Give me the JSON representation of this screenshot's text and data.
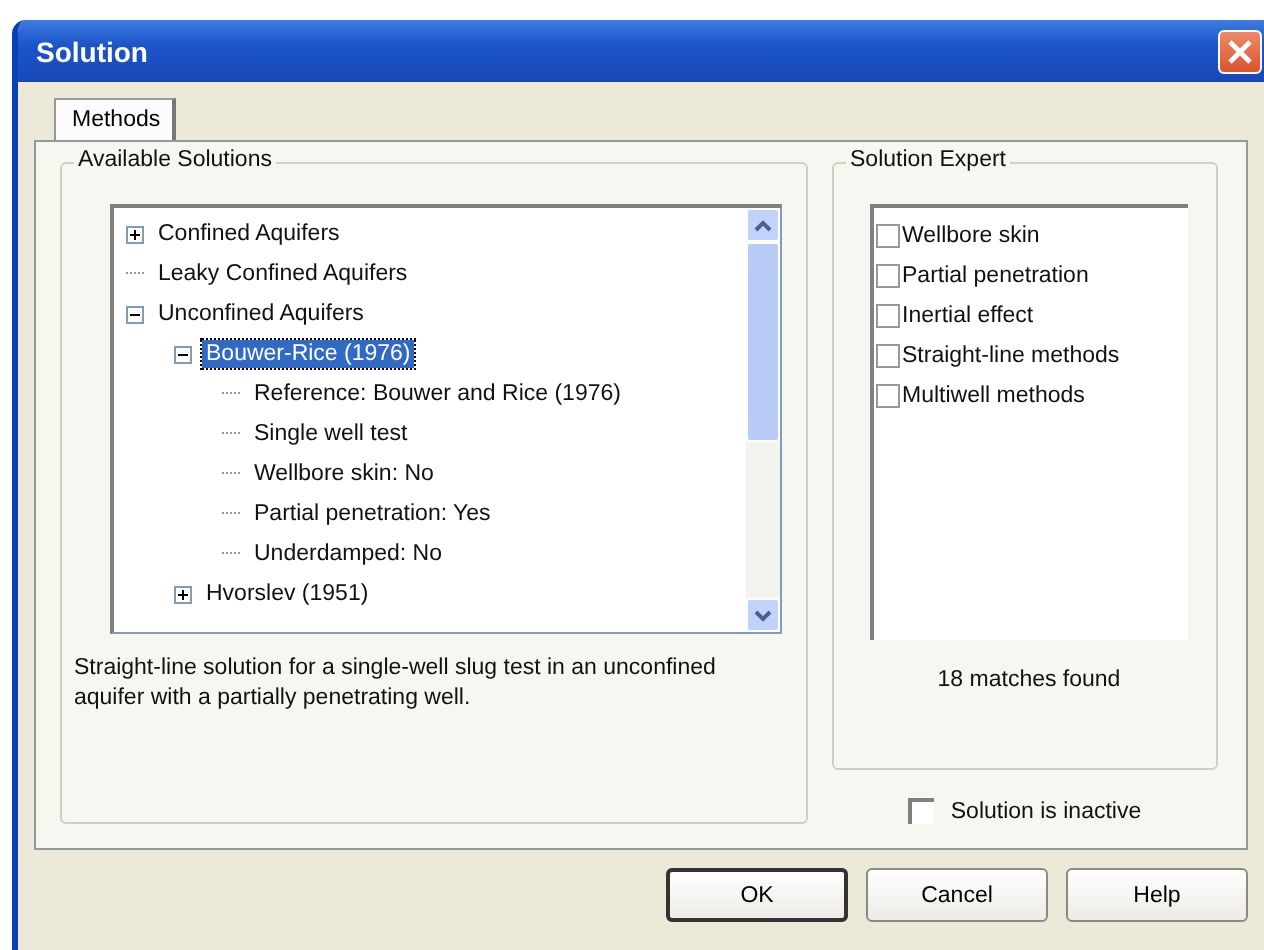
{
  "window": {
    "title": "Solution"
  },
  "tabs": [
    {
      "label": "Methods",
      "selected": true
    }
  ],
  "available_solutions": {
    "title": "Available Solutions",
    "tree": [
      {
        "label": "Confined Aquifers",
        "expanded": false,
        "selected": false
      },
      {
        "label": "Leaky Confined Aquifers",
        "selected": false
      },
      {
        "label": "Unconfined Aquifers",
        "expanded": true,
        "selected": false,
        "children": [
          {
            "label": "Bouwer-Rice (1976)",
            "expanded": true,
            "selected": true,
            "children": [
              {
                "label": "Reference: Bouwer and Rice (1976)",
                "selected": false
              },
              {
                "label": "Single well test",
                "selected": false
              },
              {
                "label": "Wellbore skin: No",
                "selected": false
              },
              {
                "label": "Partial penetration: Yes",
                "selected": false
              },
              {
                "label": "Underdamped: No",
                "selected": false
              }
            ]
          },
          {
            "label": "Hvorslev (1951)",
            "expanded": false,
            "selected": false
          }
        ]
      }
    ],
    "description": "Straight-line solution for a single-well slug test in an unconfined aquifer with a partially penetrating well."
  },
  "solution_expert": {
    "title": "Solution Expert",
    "options": [
      {
        "label": "Wellbore skin",
        "checked": false
      },
      {
        "label": "Partial penetration",
        "checked": false
      },
      {
        "label": "Inertial effect",
        "checked": false
      },
      {
        "label": "Straight-line methods",
        "checked": false
      },
      {
        "label": "Multiwell methods",
        "checked": false
      }
    ],
    "matches": "18 matches found"
  },
  "inactive": {
    "label": "Solution is inactive",
    "checked": false
  },
  "buttons": [
    {
      "label": "OK",
      "default": true
    },
    {
      "label": "Cancel",
      "default": false
    },
    {
      "label": "Help",
      "default": false
    }
  ]
}
